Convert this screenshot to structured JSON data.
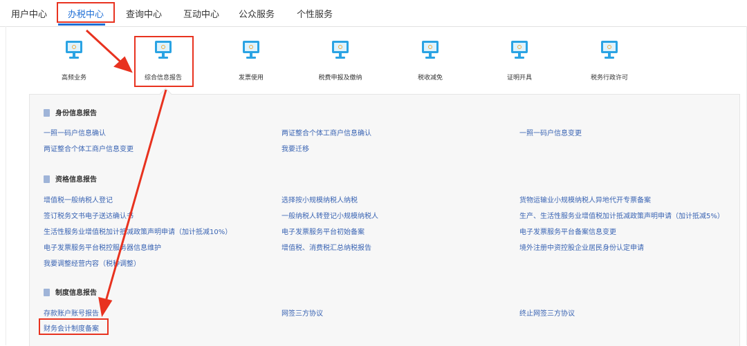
{
  "nav": {
    "tabs": [
      "用户中心",
      "办税中心",
      "查询中心",
      "互动中心",
      "公众服务",
      "个性服务"
    ],
    "active_index": 1
  },
  "services": [
    "高频业务",
    "综合信息报告",
    "发票使用",
    "税费申报及缴纳",
    "税收减免",
    "证明开具",
    "税务行政许可"
  ],
  "sections": [
    {
      "title": "身份信息报告",
      "links": [
        "一照一码户信息确认",
        "两证整合个体工商户信息确认",
        "一照一码户信息变更",
        "两证整合个体工商户信息变更",
        "我要迁移"
      ]
    },
    {
      "title": "资格信息报告",
      "links": [
        "增值税一般纳税人登记",
        "选择按小规模纳税人纳税",
        "货物运输业小规模纳税人异地代开专票备案",
        "签订税务文书电子送达确认书",
        "一般纳税人转登记小规模纳税人",
        "生产、生活性服务业增值税加计抵减政策声明申请（加计抵减5%）",
        "生活性服务业增值税加计抵减政策声明申请（加计抵减10%）",
        "电子发票服务平台初始备案",
        "电子发票服务平台备案信息变更",
        "电子发票服务平台税控服务器信息维护",
        "增值税、消费税汇总纳税报告",
        "境外注册中资控股企业居民身份认定申请",
        "我要调整经营内容（税种调整）"
      ]
    },
    {
      "title": "制度信息报告",
      "links": [
        "存款账户账号报告",
        "网签三方协议",
        "终止网签三方协议",
        "财务会计制度备案"
      ]
    }
  ],
  "colors": {
    "accent": "#1f6fd6",
    "link": "#3a64b3",
    "annotation": "#e8321f",
    "icon": "#2aa3e3"
  },
  "icons": {
    "service": "monitor-icon",
    "section": "document-icon"
  }
}
